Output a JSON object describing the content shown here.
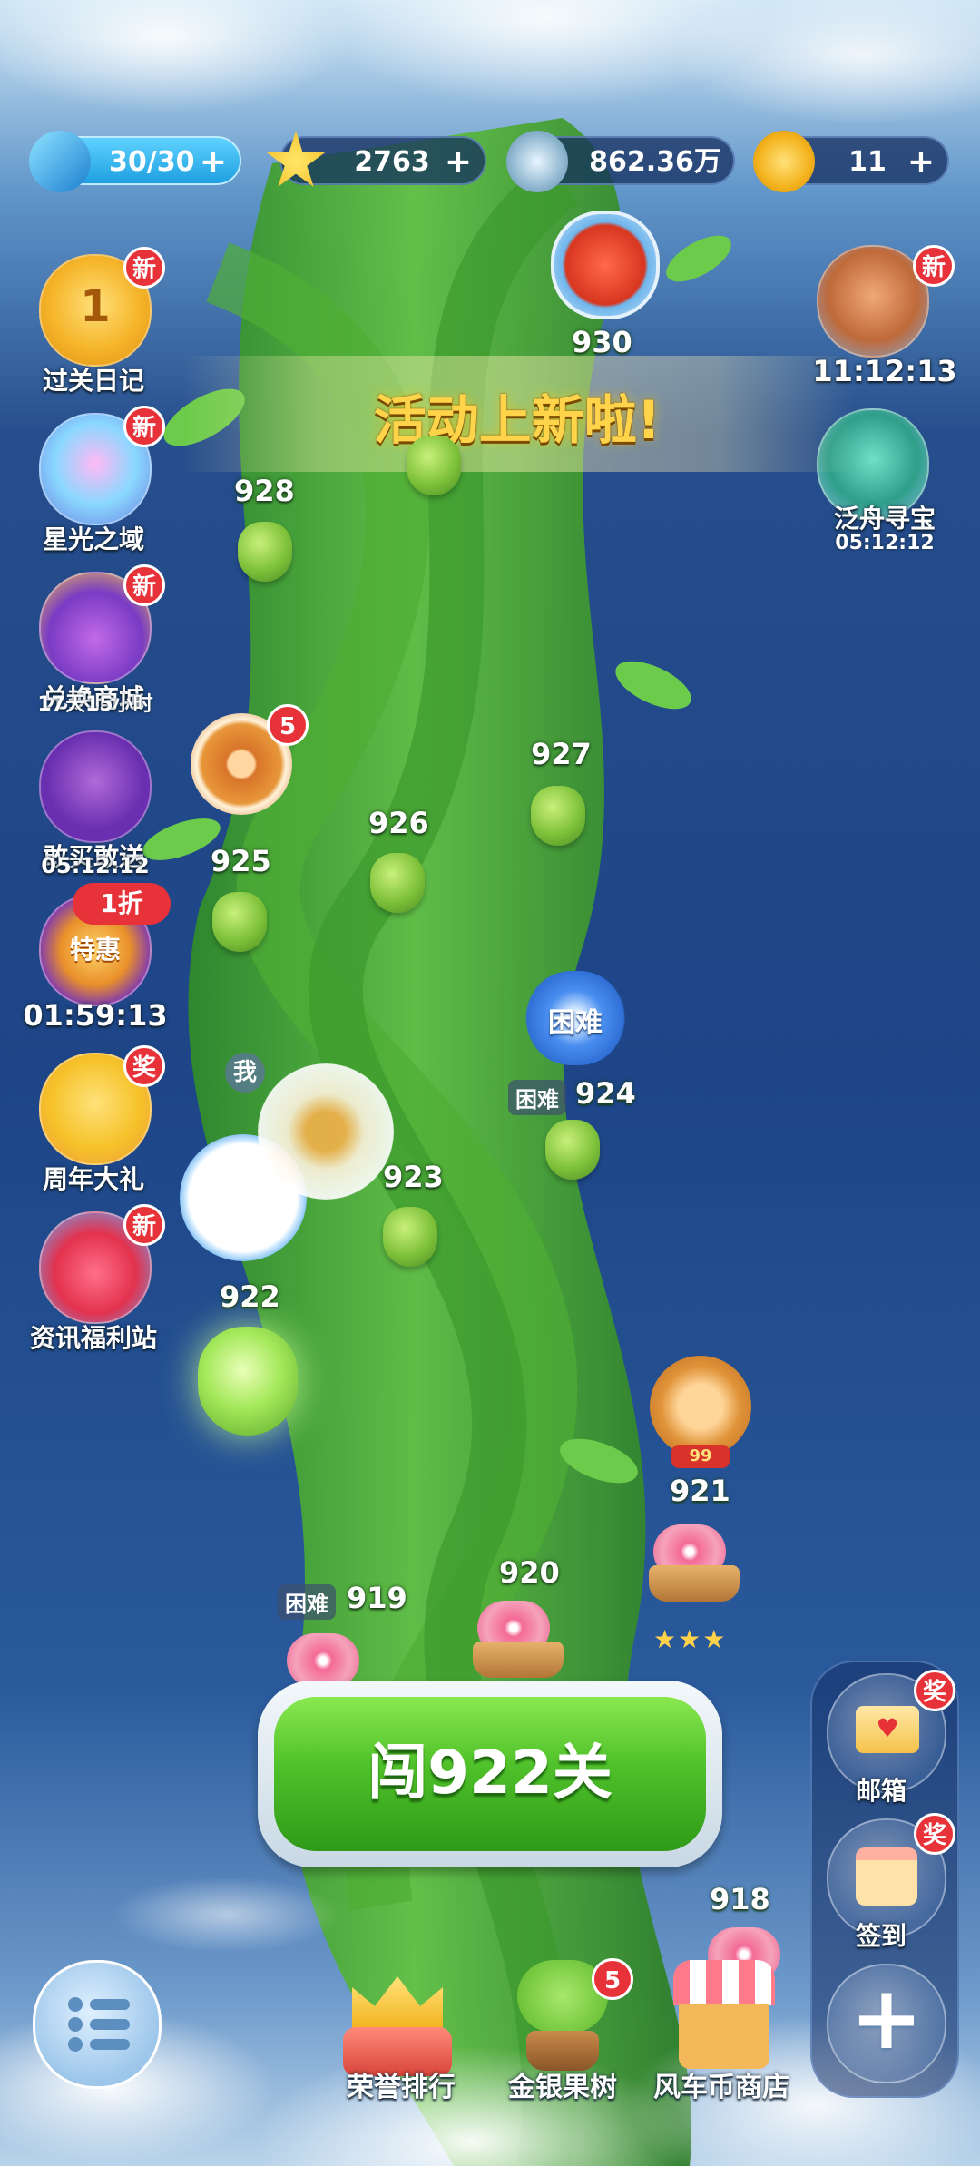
{
  "resources": {
    "energy": "30/30",
    "stars": "2763",
    "silver": "862.36万",
    "gold_coins": "11",
    "plus": "+"
  },
  "left_menu": [
    {
      "label": "过关日记",
      "badge": "新",
      "icon_text": "1"
    },
    {
      "label": "星光之域",
      "badge": "新"
    },
    {
      "label": "兑换商城",
      "badge": "新",
      "sub": "17天15小时"
    },
    {
      "label": "敢买敢送",
      "sub": "05:12:12"
    },
    {
      "label": "特惠",
      "badge": "1折",
      "sub": "01:59:13"
    },
    {
      "label": "周年大礼",
      "badge": "奖"
    },
    {
      "label": "资讯福利站",
      "badge": "新"
    }
  ],
  "right_top": [
    {
      "timer": "11:12:13",
      "badge": "新"
    },
    {
      "label": "泛舟寻宝",
      "sub": "05:12:12"
    }
  ],
  "banner": "活动上新啦!",
  "wheel_badge": "5",
  "levels": {
    "l930": "930",
    "l928": "928",
    "l927": "927",
    "l926": "926",
    "l925": "925",
    "l924": "924",
    "l923": "923",
    "l922": "922",
    "l921": "921",
    "l920": "920",
    "l919": "919",
    "l918": "918"
  },
  "hard_label": "困难",
  "me_label": "我",
  "lion_level": "99",
  "main_button": "闯922关",
  "bottom_nav": {
    "ranking": "荣誉排行",
    "tree": "金银果树",
    "tree_badge": "5",
    "shop": "风车币商店"
  },
  "right_panel": {
    "mail": "邮箱",
    "mail_badge": "奖",
    "checkin": "签到",
    "checkin_badge": "奖",
    "more": "+"
  }
}
